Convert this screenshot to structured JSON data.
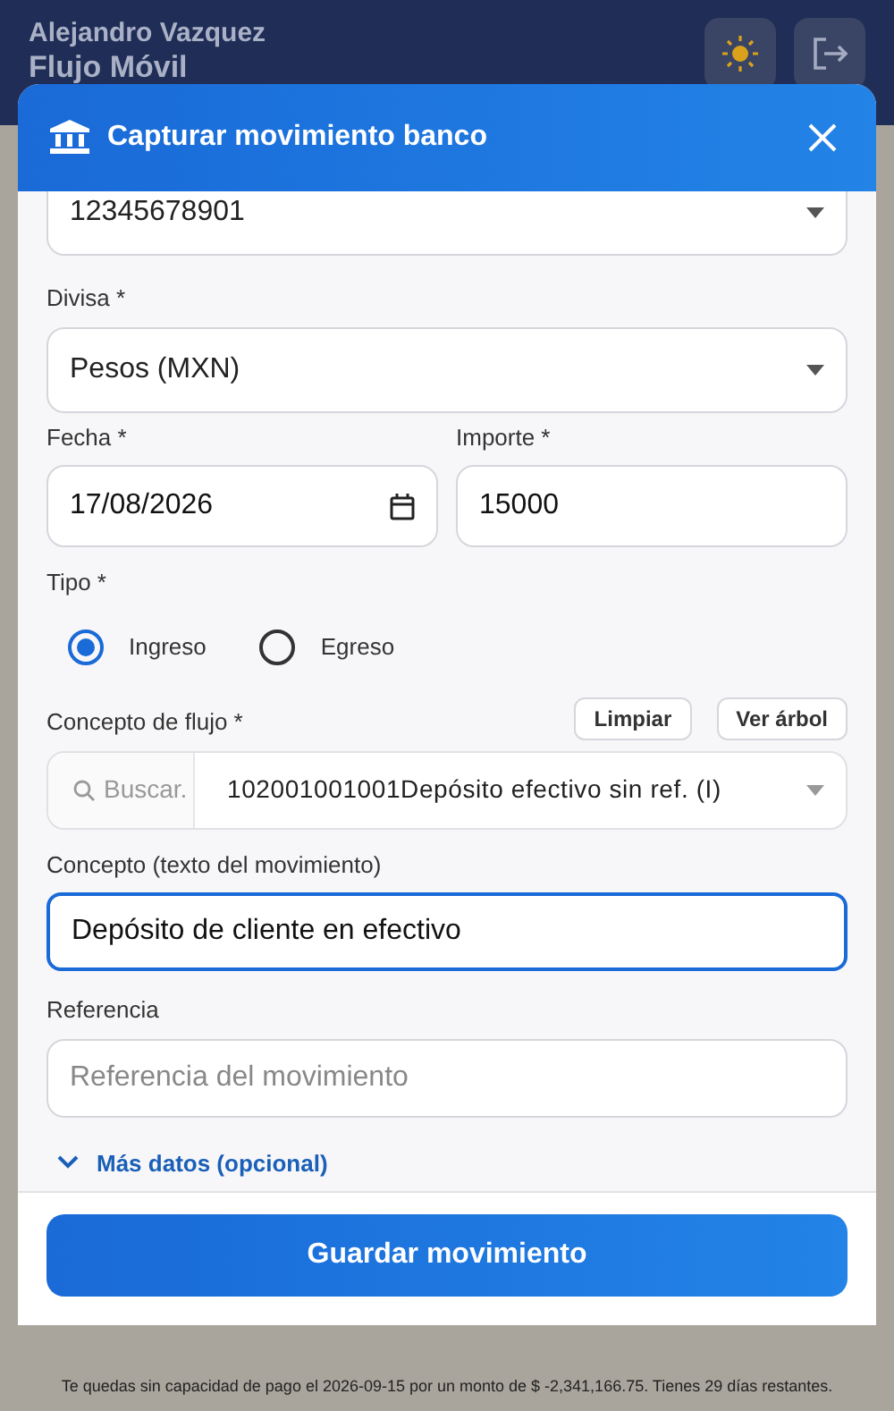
{
  "app_header": {
    "user": "Alejandro Vazquez",
    "title": "Flujo Móvil"
  },
  "modal": {
    "title": "Capturar movimiento banco",
    "account": {
      "value": "12345678901"
    },
    "currency": {
      "label": "Divisa *",
      "value": "Pesos (MXN)"
    },
    "date": {
      "label": "Fecha *",
      "value": "17/08/2026"
    },
    "amount": {
      "label": "Importe *",
      "value": "15000"
    },
    "type": {
      "label": "Tipo *",
      "options": [
        {
          "label": "Ingreso",
          "selected": true
        },
        {
          "label": "Egreso",
          "selected": false
        }
      ]
    },
    "flow_concept": {
      "label": "Concepto de flujo *",
      "buttons": [
        "Limpiar",
        "Ver árbol"
      ],
      "search_placeholder": "Buscar.",
      "value": "102001001001Depósito efectivo sin ref. (I)"
    },
    "concept": {
      "label": "Concepto (texto del movimiento)",
      "value": "Depósito de cliente en efectivo",
      "focused": true
    },
    "reference": {
      "label": "Referencia",
      "placeholder": "Referencia del movimiento"
    },
    "more": {
      "label": "Más datos (opcional)",
      "expanded": false
    },
    "save_button": "Guardar movimiento"
  },
  "footer_notice": "Te quedas sin capacidad de pago el 2026-09-15 por un monto de $ -2,341,166.75. Tienes 29 días restantes."
}
